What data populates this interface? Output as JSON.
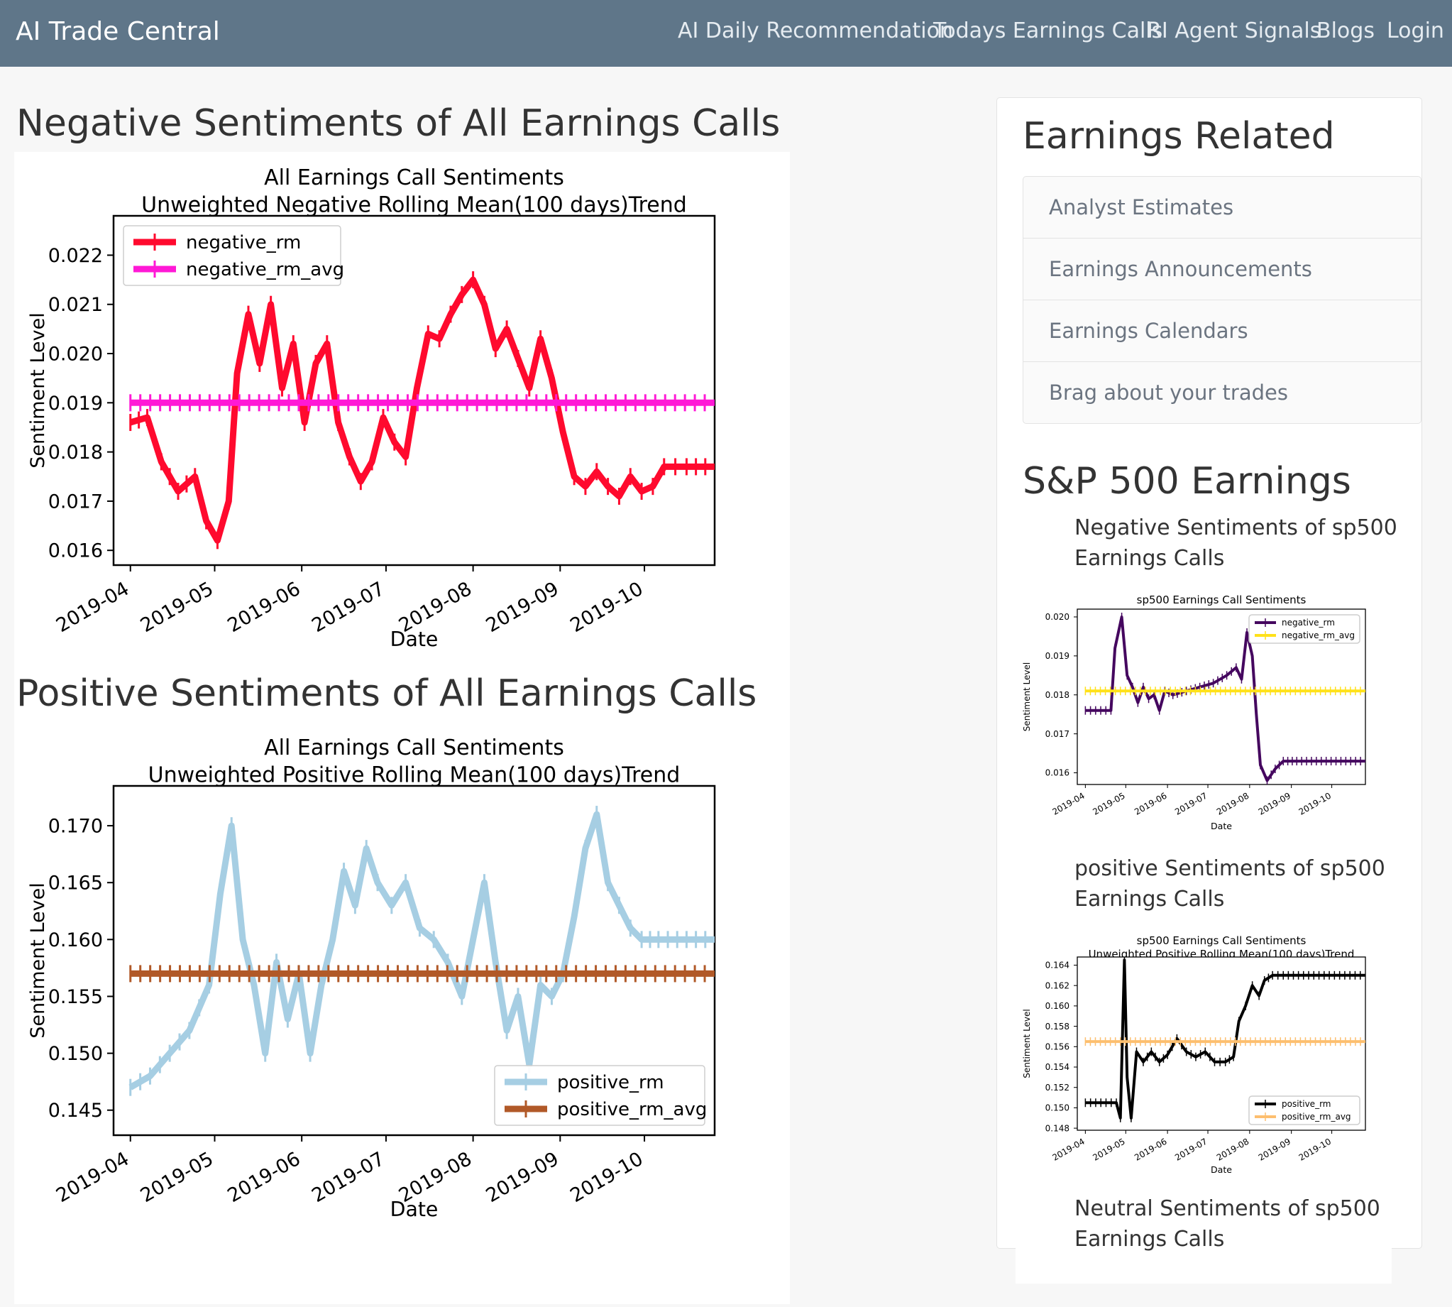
{
  "navbar": {
    "brand": "AI Trade Central",
    "links": [
      "AI Daily Recommendation",
      "Todays Earnings Calls",
      "RI Agent Signals",
      "Blogs",
      "Login"
    ]
  },
  "main": {
    "negative_title": "Negative Sentiments of All Earnings Calls",
    "positive_title": "Positive Sentiments of All Earnings Calls"
  },
  "sidebar": {
    "earnings_title": "Earnings Related",
    "links": [
      "Analyst Estimates",
      "Earnings Announcements",
      "Earnings Calendars",
      "Brag about your trades"
    ],
    "sp500_title": "S&P 500 Earnings",
    "sp_neg_caption": "Negative Sentiments of sp500 Earnings Calls",
    "sp_pos_caption": "positive Sentiments of sp500 Earnings Calls",
    "sp_neu_caption": "Neutral Sentiments of sp500 Earnings Calls"
  },
  "chart_data": [
    {
      "type": "line",
      "title": "All Earnings Call Sentiments\nUnweighted Negative Rolling Mean(100 days)Trend",
      "xlabel": "Date",
      "ylabel": "Sentiment Level",
      "x_ticks": [
        "2019-04",
        "2019-05",
        "2019-06",
        "2019-07",
        "2019-08",
        "2019-09",
        "2019-10"
      ],
      "y_ticks": [
        "0.016",
        "0.017",
        "0.018",
        "0.019",
        "0.020",
        "0.021",
        "0.022"
      ],
      "ylim": [
        0.0157,
        0.0228
      ],
      "legend": "top-left",
      "series": [
        {
          "name": "negative_rm",
          "color": "#ff0a2e",
          "points": [
            [
              "2019-04-01",
              0.0186
            ],
            [
              "2019-04-07",
              0.0187
            ],
            [
              "2019-04-12",
              0.0178
            ],
            [
              "2019-04-18",
              0.0172
            ],
            [
              "2019-04-24",
              0.0175
            ],
            [
              "2019-04-28",
              0.0166
            ],
            [
              "2019-05-02",
              0.0162
            ],
            [
              "2019-05-06",
              0.017
            ],
            [
              "2019-05-09",
              0.0196
            ],
            [
              "2019-05-13",
              0.0208
            ],
            [
              "2019-05-17",
              0.0198
            ],
            [
              "2019-05-21",
              0.021
            ],
            [
              "2019-05-25",
              0.0193
            ],
            [
              "2019-05-29",
              0.0202
            ],
            [
              "2019-06-02",
              0.0186
            ],
            [
              "2019-06-06",
              0.0198
            ],
            [
              "2019-06-10",
              0.0202
            ],
            [
              "2019-06-14",
              0.0186
            ],
            [
              "2019-06-18",
              0.0179
            ],
            [
              "2019-06-22",
              0.0174
            ],
            [
              "2019-06-26",
              0.0178
            ],
            [
              "2019-06-30",
              0.0187
            ],
            [
              "2019-07-04",
              0.0182
            ],
            [
              "2019-07-08",
              0.0179
            ],
            [
              "2019-07-12",
              0.0193
            ],
            [
              "2019-07-16",
              0.0204
            ],
            [
              "2019-07-20",
              0.0203
            ],
            [
              "2019-07-24",
              0.0208
            ],
            [
              "2019-07-28",
              0.0212
            ],
            [
              "2019-08-01",
              0.0215
            ],
            [
              "2019-08-05",
              0.021
            ],
            [
              "2019-08-09",
              0.0201
            ],
            [
              "2019-08-13",
              0.0205
            ],
            [
              "2019-08-17",
              0.0199
            ],
            [
              "2019-08-21",
              0.0193
            ],
            [
              "2019-08-25",
              0.0203
            ],
            [
              "2019-08-29",
              0.0195
            ],
            [
              "2019-09-02",
              0.0184
            ],
            [
              "2019-09-06",
              0.0175
            ],
            [
              "2019-09-10",
              0.0173
            ],
            [
              "2019-09-14",
              0.0176
            ],
            [
              "2019-09-18",
              0.0173
            ],
            [
              "2019-09-22",
              0.0171
            ],
            [
              "2019-09-26",
              0.0175
            ],
            [
              "2019-09-30",
              0.0172
            ],
            [
              "2019-10-04",
              0.0173
            ],
            [
              "2019-10-08",
              0.0177
            ],
            [
              "2019-10-16",
              0.0177
            ],
            [
              "2019-10-26",
              0.0177
            ]
          ]
        },
        {
          "name": "negative_rm_avg",
          "color": "#ff19d6",
          "points": [
            [
              "2019-04-01",
              0.019
            ],
            [
              "2019-10-26",
              0.019
            ]
          ]
        }
      ]
    },
    {
      "type": "line",
      "title": "All Earnings Call Sentiments\nUnweighted Positive Rolling Mean(100 days)Trend",
      "xlabel": "Date",
      "ylabel": "Sentiment Level",
      "x_ticks": [
        "2019-04",
        "2019-05",
        "2019-06",
        "2019-07",
        "2019-08",
        "2019-09",
        "2019-10"
      ],
      "y_ticks": [
        "0.145",
        "0.150",
        "0.155",
        "0.160",
        "0.165",
        "0.170"
      ],
      "ylim": [
        0.1428,
        0.1735
      ],
      "legend": "bottom-right",
      "series": [
        {
          "name": "positive_rm",
          "color": "#a6cee3",
          "points": [
            [
              "2019-04-01",
              0.147
            ],
            [
              "2019-04-08",
              0.148
            ],
            [
              "2019-04-15",
              0.15
            ],
            [
              "2019-04-22",
              0.152
            ],
            [
              "2019-04-29",
              0.156
            ],
            [
              "2019-05-03",
              0.164
            ],
            [
              "2019-05-07",
              0.17
            ],
            [
              "2019-05-11",
              0.16
            ],
            [
              "2019-05-15",
              0.156
            ],
            [
              "2019-05-19",
              0.15
            ],
            [
              "2019-05-23",
              0.158
            ],
            [
              "2019-05-27",
              0.153
            ],
            [
              "2019-05-31",
              0.157
            ],
            [
              "2019-06-04",
              0.15
            ],
            [
              "2019-06-08",
              0.156
            ],
            [
              "2019-06-12",
              0.16
            ],
            [
              "2019-06-16",
              0.166
            ],
            [
              "2019-06-20",
              0.163
            ],
            [
              "2019-06-24",
              0.168
            ],
            [
              "2019-06-28",
              0.165
            ],
            [
              "2019-07-03",
              0.163
            ],
            [
              "2019-07-08",
              0.165
            ],
            [
              "2019-07-13",
              0.161
            ],
            [
              "2019-07-18",
              0.16
            ],
            [
              "2019-07-23",
              0.158
            ],
            [
              "2019-07-28",
              0.155
            ],
            [
              "2019-08-01",
              0.16
            ],
            [
              "2019-08-05",
              0.165
            ],
            [
              "2019-08-09",
              0.158
            ],
            [
              "2019-08-13",
              0.152
            ],
            [
              "2019-08-17",
              0.155
            ],
            [
              "2019-08-21",
              0.149
            ],
            [
              "2019-08-25",
              0.156
            ],
            [
              "2019-08-29",
              0.155
            ],
            [
              "2019-09-02",
              0.157
            ],
            [
              "2019-09-06",
              0.162
            ],
            [
              "2019-09-10",
              0.168
            ],
            [
              "2019-09-14",
              0.171
            ],
            [
              "2019-09-18",
              0.165
            ],
            [
              "2019-09-22",
              0.163
            ],
            [
              "2019-09-26",
              0.161
            ],
            [
              "2019-09-30",
              0.16
            ],
            [
              "2019-10-06",
              0.16
            ],
            [
              "2019-10-16",
              0.16
            ],
            [
              "2019-10-26",
              0.16
            ]
          ]
        },
        {
          "name": "positive_rm_avg",
          "color": "#b15928",
          "points": [
            [
              "2019-04-01",
              0.157
            ],
            [
              "2019-10-26",
              0.157
            ]
          ]
        }
      ]
    },
    {
      "type": "line",
      "title": "sp500 Earnings Call Sentiments\nUnweighted Negative Rolling Mean(100 days)Trend",
      "xlabel": "Date",
      "ylabel": "Sentiment Level",
      "x_ticks": [
        "2019-04",
        "2019-05",
        "2019-06",
        "2019-07",
        "2019-08",
        "2019-09",
        "2019-10"
      ],
      "y_ticks": [
        "0.016",
        "0.017",
        "0.018",
        "0.019",
        "0.020"
      ],
      "ylim": [
        0.0157,
        0.0202
      ],
      "legend": "top-right",
      "series": [
        {
          "name": "negative_rm",
          "color": "#45075f",
          "points": [
            [
              "2019-04-01",
              0.0176
            ],
            [
              "2019-04-20",
              0.0176
            ],
            [
              "2019-04-23",
              0.0192
            ],
            [
              "2019-04-28",
              0.02
            ],
            [
              "2019-05-02",
              0.0185
            ],
            [
              "2019-05-06",
              0.0182
            ],
            [
              "2019-05-10",
              0.0178
            ],
            [
              "2019-05-14",
              0.0182
            ],
            [
              "2019-05-18",
              0.0179
            ],
            [
              "2019-05-22",
              0.018
            ],
            [
              "2019-05-26",
              0.0176
            ],
            [
              "2019-05-30",
              0.0181
            ],
            [
              "2019-06-05",
              0.018
            ],
            [
              "2019-06-15",
              0.0181
            ],
            [
              "2019-06-25",
              0.0182
            ],
            [
              "2019-07-05",
              0.0183
            ],
            [
              "2019-07-15",
              0.0185
            ],
            [
              "2019-07-22",
              0.0187
            ],
            [
              "2019-07-26",
              0.0184
            ],
            [
              "2019-07-30",
              0.0196
            ],
            [
              "2019-08-03",
              0.019
            ],
            [
              "2019-08-06",
              0.0175
            ],
            [
              "2019-08-09",
              0.0162
            ],
            [
              "2019-08-14",
              0.0158
            ],
            [
              "2019-08-20",
              0.0161
            ],
            [
              "2019-08-26",
              0.0163
            ],
            [
              "2019-09-05",
              0.0163
            ],
            [
              "2019-10-26",
              0.0163
            ]
          ]
        },
        {
          "name": "negative_rm_avg",
          "color": "#ffe119",
          "points": [
            [
              "2019-04-01",
              0.0181
            ],
            [
              "2019-10-26",
              0.0181
            ]
          ]
        }
      ]
    },
    {
      "type": "line",
      "title": "sp500 Earnings Call Sentiments\nUnweighted Positive Rolling Mean(100 days)Trend",
      "xlabel": "Date",
      "ylabel": "Sentiment Level",
      "x_ticks": [
        "2019-04",
        "2019-05",
        "2019-06",
        "2019-07",
        "2019-08",
        "2019-09",
        "2019-10"
      ],
      "y_ticks": [
        "0.148",
        "0.150",
        "0.152",
        "0.154",
        "0.156",
        "0.158",
        "0.160",
        "0.162",
        "0.164"
      ],
      "ylim": [
        0.1478,
        0.1648
      ],
      "legend": "bottom-right",
      "series": [
        {
          "name": "positive_rm",
          "color": "#000000",
          "points": [
            [
              "2019-04-01",
              0.1505
            ],
            [
              "2019-04-24",
              0.1505
            ],
            [
              "2019-04-27",
              0.149
            ],
            [
              "2019-04-30",
              0.1645
            ],
            [
              "2019-05-02",
              0.153
            ],
            [
              "2019-05-05",
              0.149
            ],
            [
              "2019-05-09",
              0.1555
            ],
            [
              "2019-05-14",
              0.1545
            ],
            [
              "2019-05-20",
              0.1555
            ],
            [
              "2019-05-26",
              0.1545
            ],
            [
              "2019-06-01",
              0.1552
            ],
            [
              "2019-06-08",
              0.1568
            ],
            [
              "2019-06-15",
              0.1555
            ],
            [
              "2019-06-22",
              0.155
            ],
            [
              "2019-06-29",
              0.1555
            ],
            [
              "2019-07-06",
              0.1545
            ],
            [
              "2019-07-14",
              0.1545
            ],
            [
              "2019-07-20",
              0.155
            ],
            [
              "2019-07-24",
              0.1585
            ],
            [
              "2019-07-29",
              0.16
            ],
            [
              "2019-08-03",
              0.162
            ],
            [
              "2019-08-08",
              0.161
            ],
            [
              "2019-08-12",
              0.1625
            ],
            [
              "2019-08-18",
              0.163
            ],
            [
              "2019-08-26",
              0.163
            ],
            [
              "2019-09-10",
              0.163
            ],
            [
              "2019-10-26",
              0.163
            ]
          ]
        },
        {
          "name": "positive_rm_avg",
          "color": "#fdbf6f",
          "points": [
            [
              "2019-04-01",
              0.1565
            ],
            [
              "2019-10-26",
              0.1565
            ]
          ]
        }
      ]
    }
  ]
}
